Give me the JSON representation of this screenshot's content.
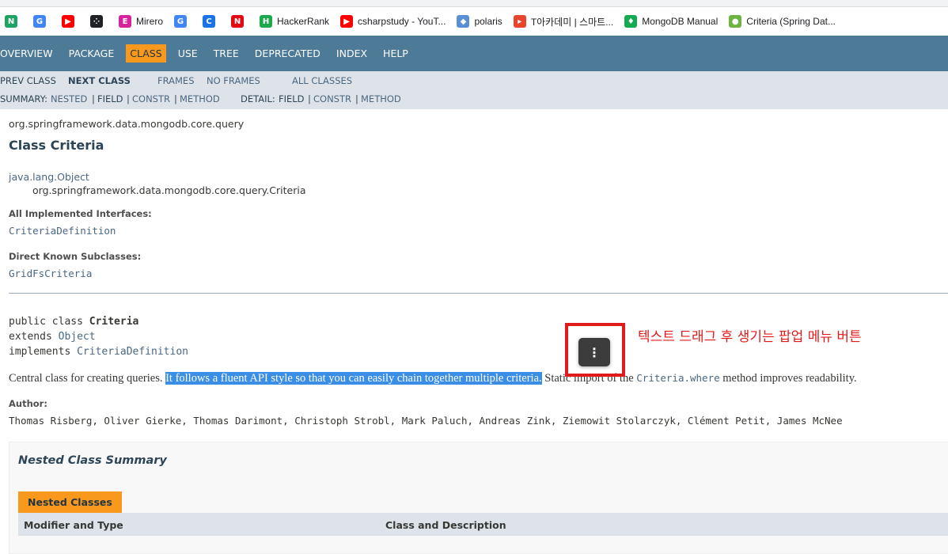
{
  "browser": {
    "bookmarks": [
      {
        "icon": "green-n-icon",
        "label": "",
        "color": "#1ea362",
        "glyph": "N"
      },
      {
        "icon": "google-icon",
        "label": "",
        "color": "#4285f4",
        "glyph": "G"
      },
      {
        "icon": "youtube-icon",
        "label": "",
        "color": "#ff0000",
        "glyph": "▶"
      },
      {
        "icon": "dots-icon",
        "label": "",
        "color": "#202124",
        "glyph": "⁘"
      },
      {
        "icon": "mirero-icon",
        "label": "Mirero",
        "color": "#d6249f",
        "glyph": "E"
      },
      {
        "icon": "translate-icon",
        "label": "",
        "color": "#4285f4",
        "glyph": "G"
      },
      {
        "icon": "chrome-icon",
        "label": "",
        "color": "#1a73e8",
        "glyph": "C"
      },
      {
        "icon": "netflix-icon",
        "label": "",
        "color": "#e50914",
        "glyph": "N"
      },
      {
        "icon": "hackerrank-icon",
        "label": "HackerRank",
        "color": "#1ba94c",
        "glyph": "H"
      },
      {
        "icon": "youtube-icon",
        "label": "csharpstudy - YouT...",
        "color": "#ff0000",
        "glyph": "▶"
      },
      {
        "icon": "polaris-icon",
        "label": "polaris",
        "color": "#5a8fd6",
        "glyph": "◆"
      },
      {
        "icon": "tacademy-icon",
        "label": "T아카데미 | 스마트...",
        "color": "#e8452c",
        "glyph": "▸"
      },
      {
        "icon": "mongodb-icon",
        "label": "MongoDB Manual",
        "color": "#13aa52",
        "glyph": "♦"
      },
      {
        "icon": "spring-icon",
        "label": "Criteria (Spring Dat...",
        "color": "#6db33f",
        "glyph": "●"
      }
    ]
  },
  "navbar": {
    "items": [
      "OVERVIEW",
      "PACKAGE",
      "CLASS",
      "USE",
      "TREE",
      "DEPRECATED",
      "INDEX",
      "HELP"
    ],
    "active": "CLASS"
  },
  "subnav": {
    "prev_class": "PREV CLASS",
    "next_class": "NEXT CLASS",
    "frames": "FRAMES",
    "no_frames": "NO FRAMES",
    "all_classes": "ALL CLASSES",
    "summary_prefix": "SUMMARY:",
    "summary_nested": "NESTED",
    "summary_field": "FIELD",
    "summary_constr": "CONSTR",
    "summary_method": "METHOD",
    "detail_prefix": "DETAIL:",
    "detail_field": "FIELD",
    "detail_constr": "CONSTR",
    "detail_method": "METHOD",
    "sep": "|"
  },
  "page": {
    "package": "org.springframework.data.mongodb.core.query",
    "title": "Class Criteria",
    "inherit_root": "java.lang.Object",
    "inherit_class": "org.springframework.data.mongodb.core.query.Criteria",
    "interfaces_label": "All Implemented Interfaces:",
    "interfaces_value": "CriteriaDefinition",
    "subclasses_label": "Direct Known Subclasses:",
    "subclasses_value": "GridFsCriteria",
    "decl_public": "public class ",
    "decl_name": "Criteria",
    "decl_extends": "extends ",
    "decl_extends_value": "Object",
    "decl_implements": "implements ",
    "decl_implements_value": "CriteriaDefinition",
    "desc_before": "Central class for creating queries. ",
    "desc_selected": "It follows a fluent API style so that you can easily chain together multiple criteria.",
    "desc_after_a": " Static import of the ",
    "desc_code": "Criteria.where",
    "desc_after_b": " method improves readability.",
    "author_label": "Author:",
    "authors": "Thomas Risberg, Oliver Gierke, Thomas Darimont, Christoph Strobl, Mark Paluch, Andreas Zink, Ziemowit Stolarczyk, Clément Petit, James McNee",
    "nested_summary_title": "Nested Class Summary",
    "nested_tab": "Nested Classes",
    "col_modifier": "Modifier and Type",
    "col_class": "Class and Description"
  },
  "overlay": {
    "popup_glyph": "⋮",
    "annotation": "텍스트 드래그 후 생기는 팝업 메뉴 버튼",
    "annotation_color": "#e01b1b"
  }
}
